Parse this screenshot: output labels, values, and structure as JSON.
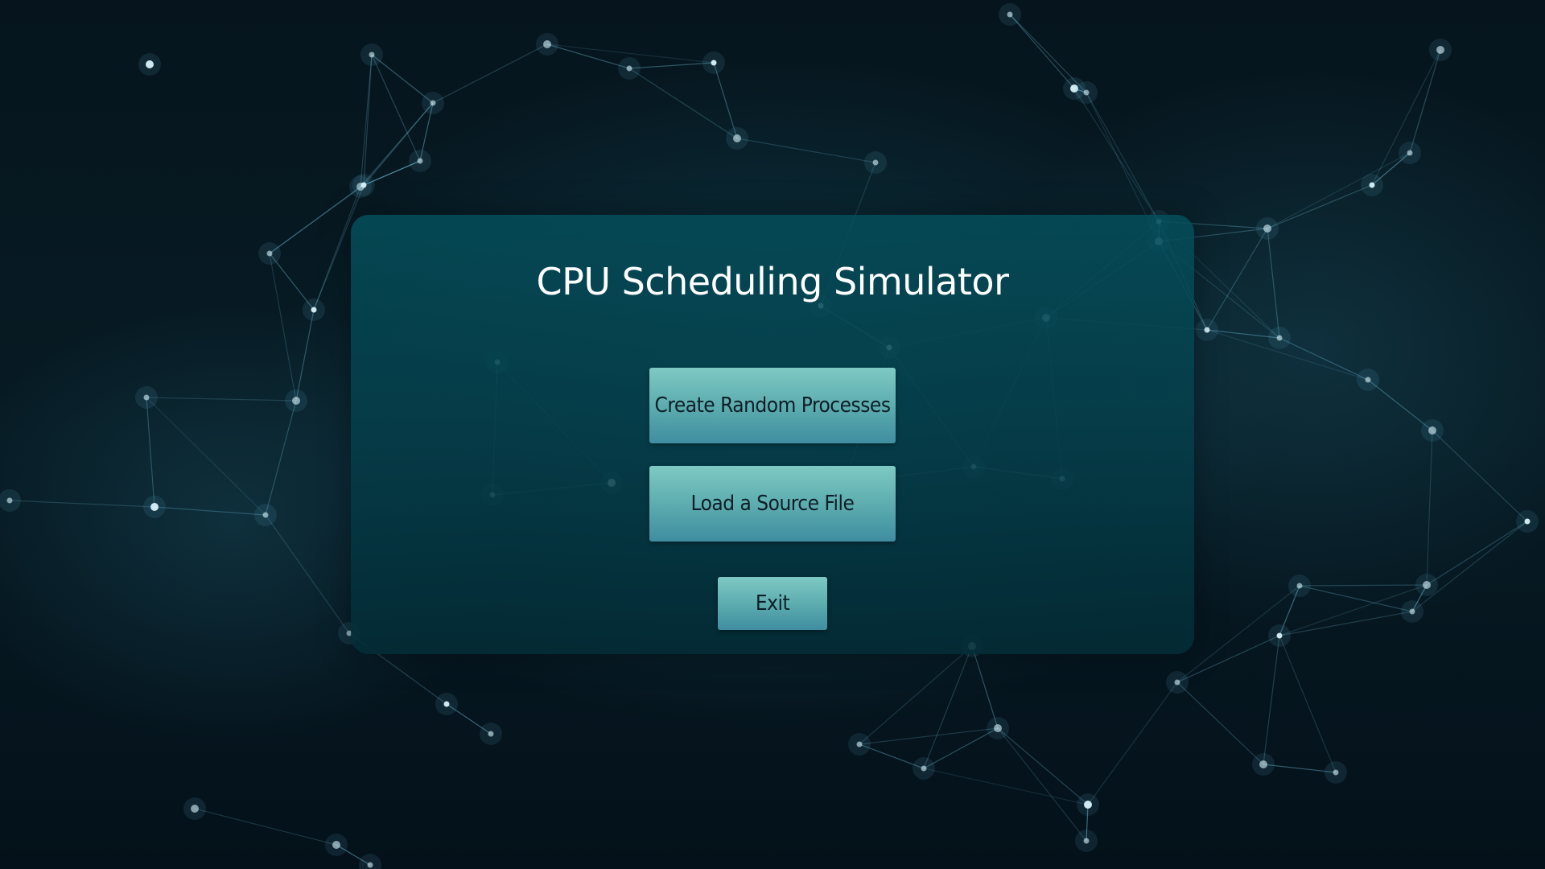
{
  "window": {
    "title": "CPU Scheduling Simulator"
  },
  "menu": {
    "create_random_label": "Create Random Processes",
    "load_file_label": "Load a Source File",
    "exit_label": "Exit"
  },
  "colors": {
    "panel": "#04505c",
    "button_top": "#7ec9c3",
    "button_bottom": "#3f8da0",
    "background": "#06151d",
    "network_line": "#7fd3ee"
  }
}
